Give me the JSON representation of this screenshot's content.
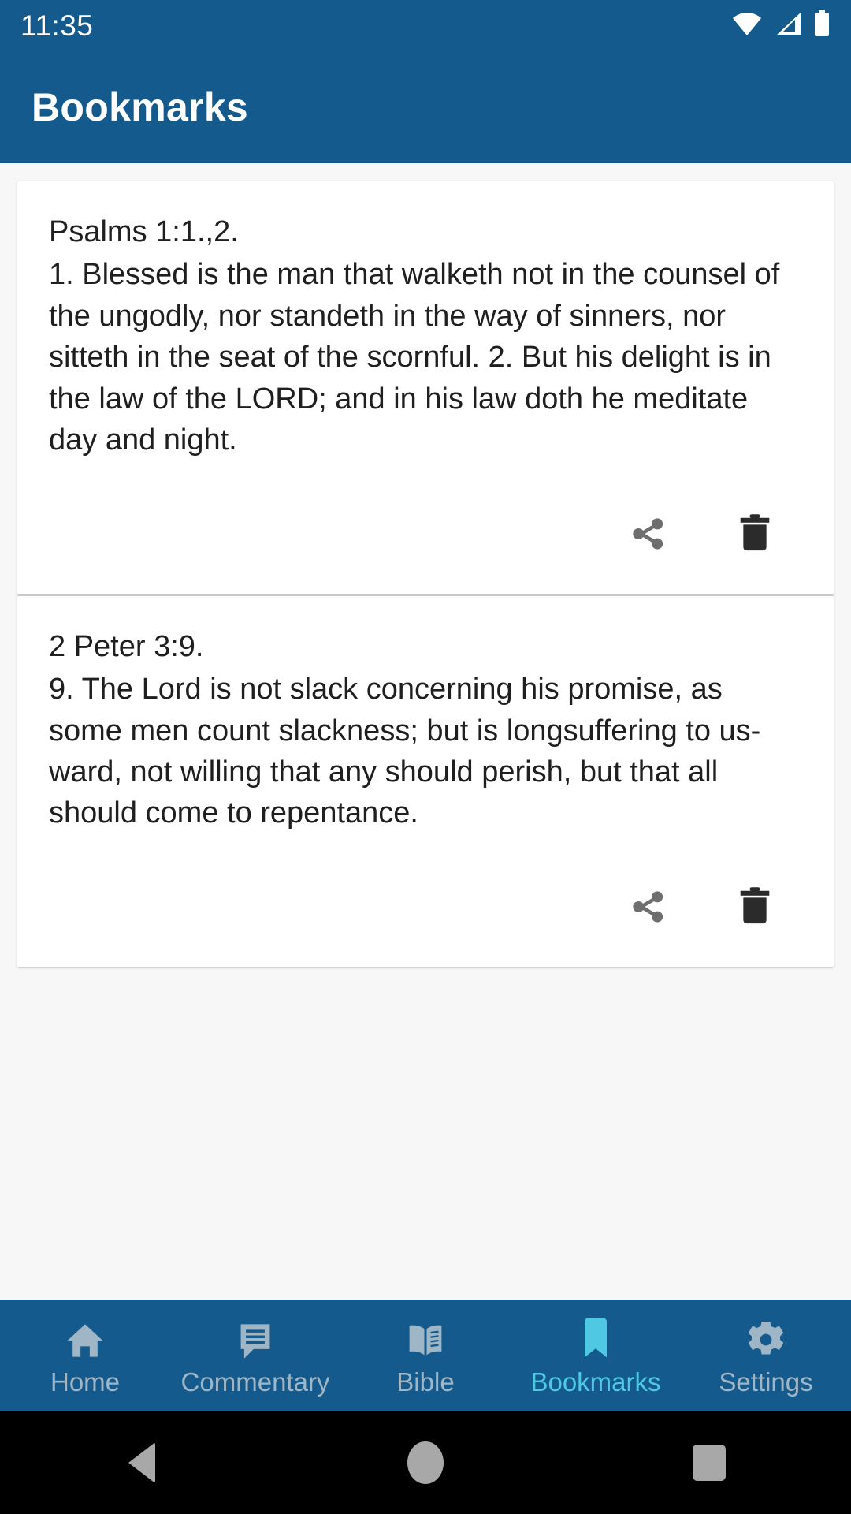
{
  "theme": {
    "primary": "#145A8D",
    "accent": "#4FC9E3",
    "nav_inactive": "#9FB6C6",
    "page_bg": "#F7F7F7",
    "card_bg": "#FFFFFF",
    "text": "#1F1F1F",
    "share_icon_color": "#6E6E6E",
    "delete_icon_color": "#2B2B2B"
  },
  "statusbar": {
    "time": "11:35",
    "icons": [
      "wifi-icon",
      "cellular-signal-icon",
      "battery-icon"
    ]
  },
  "appbar": {
    "title": "Bookmarks"
  },
  "bookmarks": [
    {
      "reference": "Psalms 1:1.,2.",
      "verse": "1. Blessed is the man that walketh not in the counsel of the ungodly, nor standeth in the way of sinners, nor sitteth in the seat of the scornful. 2. But his delight is in the law of the LORD; and in his law doth he meditate day and night.",
      "share_label": "share-icon",
      "delete_label": "delete-icon"
    },
    {
      "reference": "2 Peter 3:9.",
      "verse": "9. The Lord is not slack concerning his promise, as some men count slackness; but is longsuffering to us-ward, not willing that any should perish, but that all should come to repentance.",
      "share_label": "share-icon",
      "delete_label": "delete-icon"
    }
  ],
  "bottomnav": {
    "items": [
      {
        "label": "Home",
        "icon": "home-icon",
        "active": false
      },
      {
        "label": "Commentary",
        "icon": "comment-icon",
        "active": false
      },
      {
        "label": "Bible",
        "icon": "book-icon",
        "active": false
      },
      {
        "label": "Bookmarks",
        "icon": "bookmark-icon",
        "active": true
      },
      {
        "label": "Settings",
        "icon": "gear-icon",
        "active": false
      }
    ]
  },
  "sysnav": {
    "back": "back-icon",
    "home": "home-circle-icon",
    "recents": "recents-square-icon"
  }
}
